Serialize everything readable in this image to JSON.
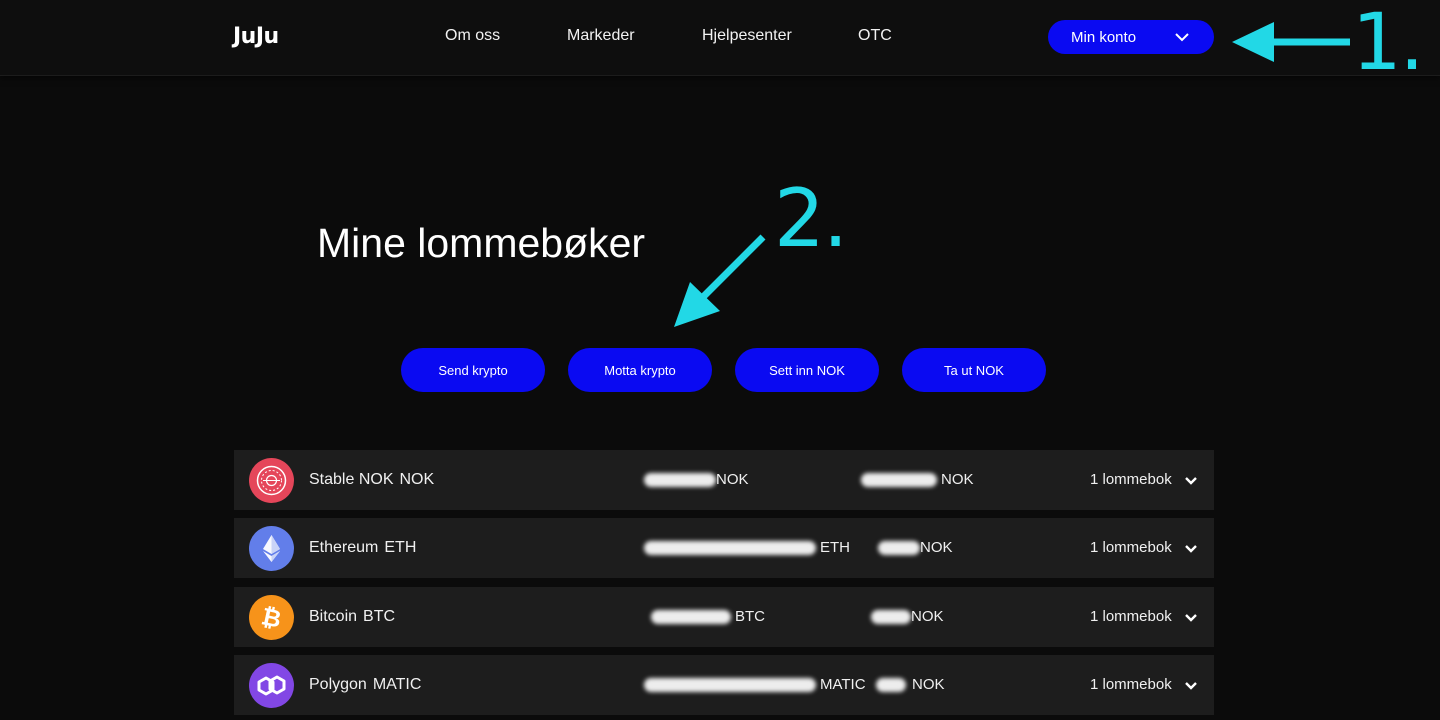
{
  "header": {
    "logo": "JuJu",
    "nav": [
      {
        "label": "Om oss"
      },
      {
        "label": "Markeder"
      },
      {
        "label": "Hjelpesenter"
      },
      {
        "label": "OTC"
      }
    ],
    "account_button": "Min konto"
  },
  "annotations": {
    "one": "1.",
    "two": "2."
  },
  "main": {
    "title": "Mine lommebøker",
    "actions": [
      {
        "label": "Send krypto"
      },
      {
        "label": "Motta krypto"
      },
      {
        "label": "Sett inn NOK"
      },
      {
        "label": "Ta ut NOK"
      }
    ],
    "wallets": [
      {
        "name": "Stable NOK",
        "symbol": "NOK",
        "balance_unit": "NOK",
        "value_unit": "NOK",
        "count": "1 lommebok",
        "icon": "stable-nok-icon"
      },
      {
        "name": "Ethereum",
        "symbol": "ETH",
        "balance_unit": "ETH",
        "value_unit": "NOK",
        "count": "1 lommebok",
        "icon": "ethereum-icon"
      },
      {
        "name": "Bitcoin",
        "symbol": "BTC",
        "balance_unit": "BTC",
        "value_unit": "NOK",
        "count": "1 lommebok",
        "icon": "bitcoin-icon"
      },
      {
        "name": "Polygon",
        "symbol": "MATIC",
        "balance_unit": "MATIC",
        "value_unit": "NOK",
        "count": "1 lommebok",
        "icon": "polygon-icon"
      }
    ]
  },
  "colors": {
    "accent_blue": "#0a0af2",
    "annotation_cyan": "#22d8e6",
    "background": "#0b0b0b",
    "row_background": "#1d1d1d",
    "stable_nok": "#e5465a",
    "ethereum": "#627eea",
    "bitcoin": "#f7931a",
    "polygon": "#8247e5"
  }
}
